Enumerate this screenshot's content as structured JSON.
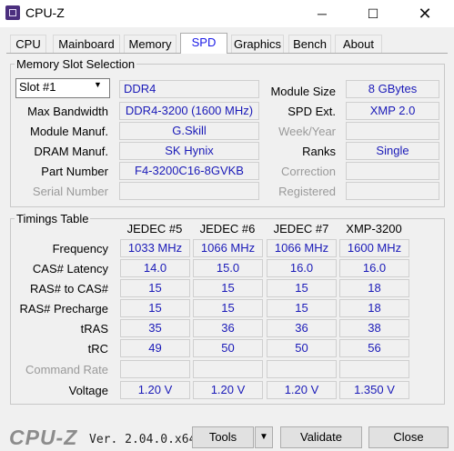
{
  "window": {
    "title": "CPU-Z",
    "minimize": "─",
    "maximize": "☐",
    "close": "✕"
  },
  "tabs": [
    {
      "label": "CPU"
    },
    {
      "label": "Mainboard"
    },
    {
      "label": "Memory"
    },
    {
      "label": "SPD",
      "active": true
    },
    {
      "label": "Graphics"
    },
    {
      "label": "Bench"
    },
    {
      "label": "About"
    }
  ],
  "slot_section": {
    "legend": "Memory Slot Selection",
    "slot_selected": "Slot #1",
    "memory_type": "DDR4",
    "left_fields": [
      {
        "label": "Max Bandwidth",
        "value": "DDR4-3200 (1600 MHz)",
        "enabled": true
      },
      {
        "label": "Module Manuf.",
        "value": "G.Skill",
        "enabled": true
      },
      {
        "label": "DRAM Manuf.",
        "value": "SK Hynix",
        "enabled": true
      },
      {
        "label": "Part Number",
        "value": "F4-3200C16-8GVKB",
        "enabled": true
      },
      {
        "label": "Serial Number",
        "value": "",
        "enabled": false
      }
    ],
    "right_fields": [
      {
        "label": "Module Size",
        "value": "8 GBytes",
        "enabled": true
      },
      {
        "label": "SPD Ext.",
        "value": "XMP 2.0",
        "enabled": true
      },
      {
        "label": "Week/Year",
        "value": "",
        "enabled": false
      },
      {
        "label": "Ranks",
        "value": "Single",
        "enabled": true
      },
      {
        "label": "Correction",
        "value": "",
        "enabled": false
      },
      {
        "label": "Registered",
        "value": "",
        "enabled": false
      }
    ]
  },
  "timings": {
    "legend": "Timings Table",
    "columns": [
      "JEDEC #5",
      "JEDEC #6",
      "JEDEC #7",
      "XMP-3200"
    ],
    "rows": [
      {
        "label": "Frequency",
        "enabled": true,
        "values": [
          "1033 MHz",
          "1066 MHz",
          "1066 MHz",
          "1600 MHz"
        ]
      },
      {
        "label": "CAS# Latency",
        "enabled": true,
        "values": [
          "14.0",
          "15.0",
          "16.0",
          "16.0"
        ]
      },
      {
        "label": "RAS# to CAS#",
        "enabled": true,
        "values": [
          "15",
          "15",
          "15",
          "18"
        ]
      },
      {
        "label": "RAS# Precharge",
        "enabled": true,
        "values": [
          "15",
          "15",
          "15",
          "18"
        ]
      },
      {
        "label": "tRAS",
        "enabled": true,
        "values": [
          "35",
          "36",
          "36",
          "38"
        ]
      },
      {
        "label": "tRC",
        "enabled": true,
        "values": [
          "49",
          "50",
          "50",
          "56"
        ]
      },
      {
        "label": "Command Rate",
        "enabled": false,
        "values": [
          "",
          "",
          "",
          ""
        ]
      },
      {
        "label": "Voltage",
        "enabled": true,
        "values": [
          "1.20 V",
          "1.20 V",
          "1.20 V",
          "1.350 V"
        ]
      }
    ]
  },
  "footer": {
    "logo": "CPU-Z",
    "version": "Ver. 2.04.0.x64",
    "tools_label": "Tools",
    "tools_arrow": "▼",
    "validate_label": "Validate",
    "close_label": "Close"
  },
  "colors": {
    "value_text": "#1a1ab8",
    "active_tab_text": "#1a1ae6",
    "app_icon": "#4b2f7e"
  }
}
